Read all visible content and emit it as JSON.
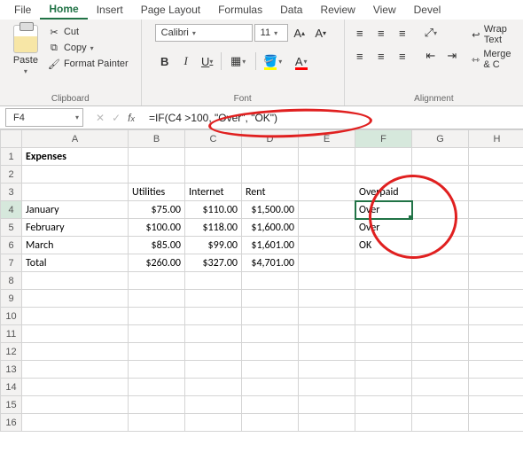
{
  "menu": {
    "file": "File",
    "home": "Home",
    "insert": "Insert",
    "page_layout": "Page Layout",
    "formulas": "Formulas",
    "data": "Data",
    "review": "Review",
    "view": "View",
    "devel": "Devel"
  },
  "ribbon": {
    "clipboard": {
      "paste": "Paste",
      "cut": "Cut",
      "copy": "Copy",
      "format_painter": "Format Painter",
      "group_label": "Clipboard"
    },
    "font": {
      "name": "Calibri",
      "size": "11",
      "group_label": "Font"
    },
    "alignment": {
      "wrap_text": "Wrap Text",
      "merge_center": "Merge & C",
      "group_label": "Alignment"
    }
  },
  "fx": {
    "name_box": "F4",
    "formula": "=IF(C4 >100, \"Over\", \"OK\")"
  },
  "columns": [
    "A",
    "B",
    "C",
    "D",
    "E",
    "F",
    "G",
    "H"
  ],
  "rows": {
    "r1": {
      "A": "Expenses"
    },
    "r3": {
      "B": "Utilities",
      "C": "Internet",
      "D": "Rent",
      "F": "Overpaid"
    },
    "r4": {
      "A": "January",
      "B": "$75.00",
      "C": "$110.00",
      "D": "$1,500.00",
      "F": "Over"
    },
    "r5": {
      "A": "February",
      "B": "$100.00",
      "C": "$118.00",
      "D": "$1,600.00",
      "F": "Over"
    },
    "r6": {
      "A": "March",
      "B": "$85.00",
      "C": "$99.00",
      "D": "$1,601.00",
      "F": "OK"
    },
    "r7": {
      "A": "Total",
      "B": "$260.00",
      "C": "$327.00",
      "D": "$4,701.00"
    }
  },
  "chart_data": {
    "type": "table",
    "title": "Expenses",
    "categories": [
      "Utilities",
      "Internet",
      "Rent"
    ],
    "series": [
      {
        "name": "January",
        "values": [
          75.0,
          110.0,
          1500.0
        ]
      },
      {
        "name": "February",
        "values": [
          100.0,
          118.0,
          1600.0
        ]
      },
      {
        "name": "March",
        "values": [
          85.0,
          99.0,
          1601.0
        ]
      },
      {
        "name": "Total",
        "values": [
          260.0,
          327.0,
          4701.0
        ]
      }
    ],
    "derived": {
      "label": "Overpaid",
      "formula": "=IF(C4 >100, \"Over\", \"OK\")",
      "values": [
        "Over",
        "Over",
        "OK"
      ]
    }
  }
}
